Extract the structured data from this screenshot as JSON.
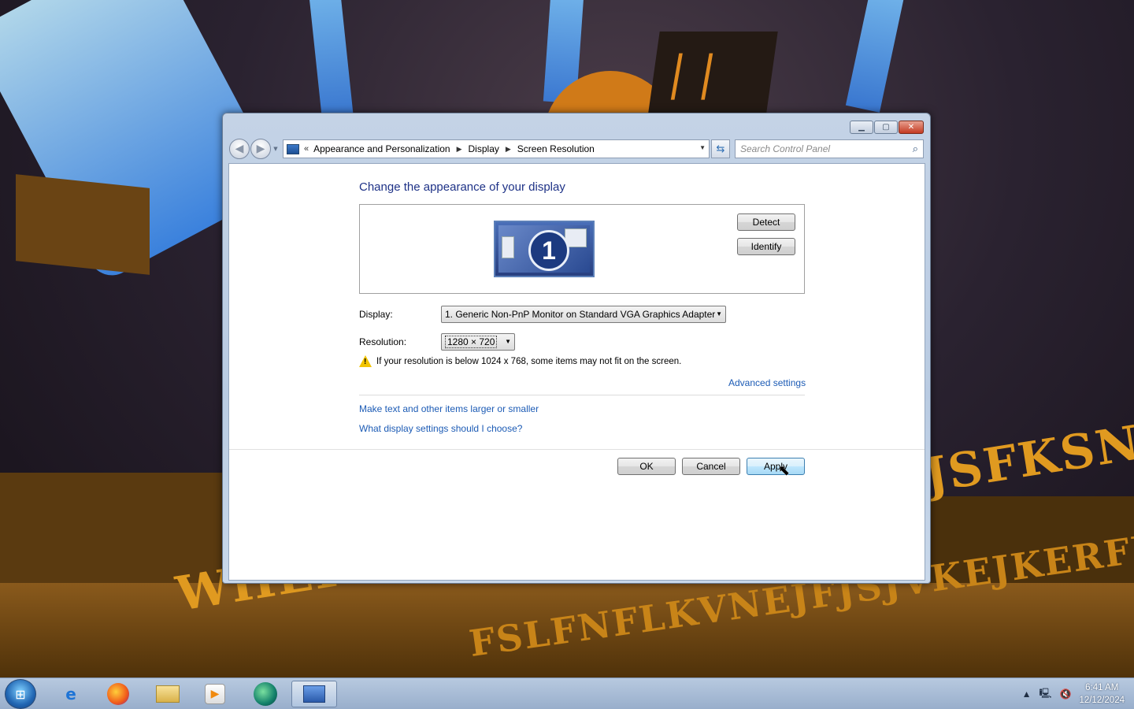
{
  "wallpaper": {
    "scroll_line_1": "WHEFHWJFIOWJFLKSHGKJSFKSNKFSLFNE",
    "scroll_line_2": "FSLFNFLKVNEJFJSJVKEJKERFKAJN"
  },
  "window": {
    "breadcrumb": [
      "Appearance and Personalization",
      "Display",
      "Screen Resolution"
    ],
    "search_placeholder": "Search Control Panel",
    "page_title": "Change the appearance of your display",
    "monitor_number": "1",
    "detect_label": "Detect",
    "identify_label": "Identify",
    "display_label": "Display:",
    "display_value": "1. Generic Non-PnP Monitor on Standard VGA Graphics Adapter",
    "resolution_label": "Resolution:",
    "resolution_value": "1280 × 720",
    "warning_text": "If your resolution is below 1024 x 768, some items may not fit on the screen.",
    "advanced_link": "Advanced settings",
    "text_size_link": "Make text and other items larger or smaller",
    "choose_link": "What display settings should I choose?",
    "ok_label": "OK",
    "cancel_label": "Cancel",
    "apply_label": "Apply"
  },
  "taskbar": {
    "apps": [
      "start",
      "internet-explorer",
      "firefox",
      "windows-explorer",
      "media-player",
      "green-app",
      "control-panel"
    ],
    "time": "6:41 AM",
    "date": "12/12/2024"
  }
}
